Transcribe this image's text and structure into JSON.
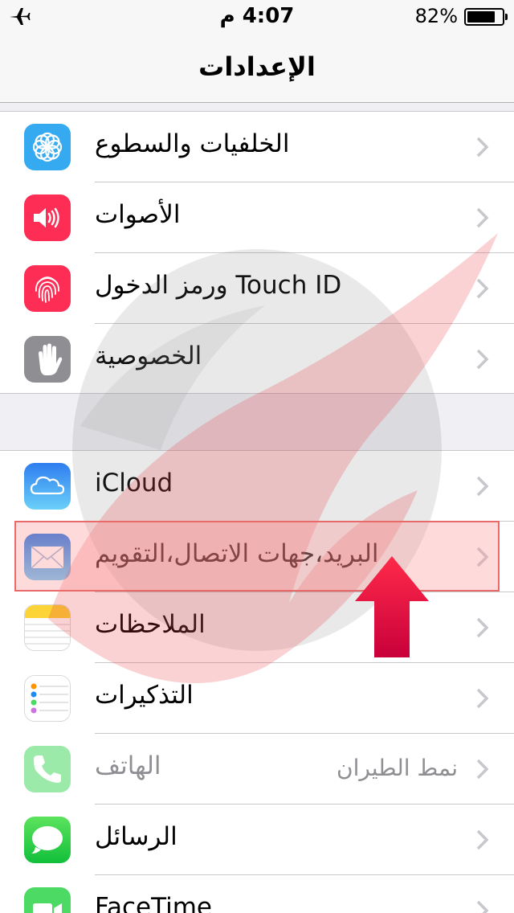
{
  "status_bar": {
    "time": "4:07 م",
    "battery_percent": "82%",
    "battery_level": 0.82
  },
  "nav": {
    "title": "الإعدادات"
  },
  "group1": [
    {
      "label": "الخلفيات والسطوع",
      "icon": "wallpaper-icon",
      "color": "#35aaf1"
    },
    {
      "label": "الأصوات",
      "icon": "sounds-icon",
      "color": "#fe2d55"
    },
    {
      "label": "Touch ID ورمز الدخول",
      "icon": "fingerprint-icon",
      "color": "#fe2d55"
    },
    {
      "label": "الخصوصية",
      "icon": "hand-icon",
      "color": "#8e8e93"
    }
  ],
  "group2": [
    {
      "label": "iCloud",
      "icon": "cloud-icon",
      "color": "#3d9bf5"
    },
    {
      "label": "البريد،جهات الاتصال،التقويم",
      "icon": "mail-icon",
      "color": "#1d8cf0"
    },
    {
      "label": "الملاحظات",
      "icon": "notes-icon",
      "color": "#fcd437"
    },
    {
      "label": "التذكيرات",
      "icon": "reminders-icon",
      "color": "#ffffff"
    },
    {
      "label": "الهاتف",
      "value": "نمط الطيران",
      "icon": "phone-icon",
      "color": "#4cd964"
    },
    {
      "label": "الرسائل",
      "icon": "messages-icon",
      "color": "#4cd964"
    },
    {
      "label": "FaceTime",
      "icon": "facetime-icon",
      "color": "#4cd964"
    }
  ],
  "colors": {
    "highlight_border": "#e86a6a",
    "arrow": "#e0102f",
    "watermark_red": "#e8343a"
  }
}
